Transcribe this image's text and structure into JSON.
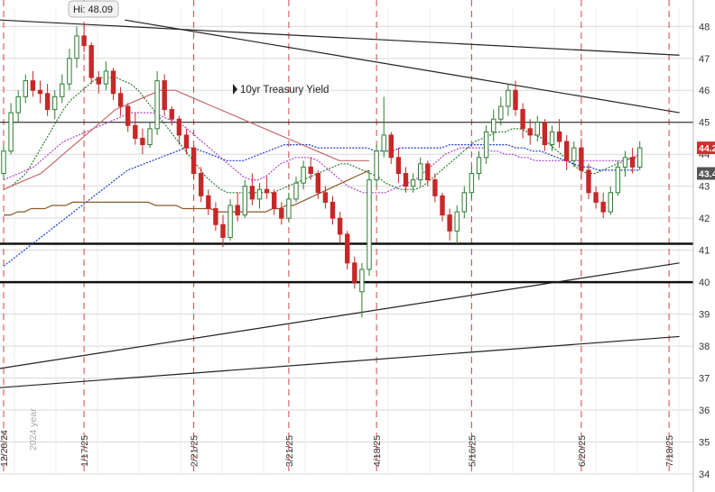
{
  "chart_data": {
    "type": "candlestick",
    "title": "10yr Treasury Yield",
    "high_label": "Hi: 48.09",
    "ylim": [
      34,
      48.6
    ],
    "y_ticks": [
      34,
      35,
      36,
      37,
      38,
      39,
      40,
      41,
      42,
      43,
      44,
      45,
      46,
      47,
      48
    ],
    "y_tick_labels": [
      "34",
      "35",
      "36",
      "37",
      "38",
      "39",
      "40",
      "41",
      "42",
      "43",
      "44",
      "45",
      "46",
      "47",
      "48"
    ],
    "date_labels": [
      "12/20/24",
      "1/17/25",
      "2/21/25",
      "3/21/25",
      "4/18/25",
      "5/16/25",
      "6/20/25",
      "7/18/25"
    ],
    "year_label": "2024 year",
    "price_tags": [
      {
        "text": "44.2",
        "value": 44.2,
        "color": "#d32f2f"
      },
      {
        "text": "43.4",
        "value": 43.4,
        "color": "#555555"
      }
    ],
    "horizontal_lines": [
      45.0,
      41.2,
      40.0
    ],
    "trendlines": [
      {
        "x0": 0,
        "y0": 48.2,
        "x1": 98,
        "y1": 47.1
      },
      {
        "x0": 18,
        "y0": 48.2,
        "x1": 98,
        "y1": 45.3
      },
      {
        "x0": 0,
        "y0": 37.3,
        "x1": 98,
        "y1": 40.6
      },
      {
        "x0": 0,
        "y0": 36.7,
        "x1": 98,
        "y1": 38.3
      }
    ],
    "date_index": [
      0,
      11,
      26,
      39,
      51,
      64,
      79,
      91
    ],
    "series": [
      {
        "name": "",
        "color": "#2e7d32",
        "style": "dashed",
        "values": [
          42.9,
          43.0,
          43.2,
          43.4,
          43.8,
          44.2,
          44.6,
          45.0,
          45.4,
          45.7,
          45.9,
          46.1,
          46.3,
          46.4,
          46.4,
          46.4,
          46.3,
          46.2,
          46.0,
          45.7,
          45.4,
          45.1,
          44.8,
          44.5,
          44.2,
          43.9,
          43.6,
          43.3,
          43.1,
          42.9,
          42.8,
          42.8,
          42.8,
          42.8,
          42.8,
          42.8,
          42.8,
          42.9,
          43.0,
          43.1,
          43.2,
          43.3,
          43.4,
          43.5,
          43.6,
          43.7,
          43.7,
          43.6,
          43.5,
          43.4,
          43.3,
          43.1,
          43.0,
          42.9,
          42.9,
          42.9,
          43.0,
          43.2,
          43.4,
          43.6,
          43.8,
          44.0,
          44.2,
          44.4,
          44.5,
          44.6,
          44.7,
          44.7,
          44.8,
          44.8,
          44.7,
          44.6,
          44.5,
          44.3,
          44.1,
          43.9,
          43.7,
          43.5,
          43.4,
          43.4,
          43.5,
          43.6,
          43.7,
          43.8,
          43.9,
          43.9
        ]
      },
      {
        "name": "",
        "color": "#b044c8",
        "style": "dashed",
        "values": [
          43.2,
          43.3,
          43.4,
          43.5,
          43.6,
          43.8,
          44.0,
          44.2,
          44.4,
          44.5,
          44.6,
          44.7,
          44.8,
          44.9,
          45.0,
          45.1,
          45.2,
          45.3,
          45.3,
          45.3,
          45.3,
          45.2,
          45.1,
          45.0,
          44.9,
          44.7,
          44.5,
          44.3,
          44.1,
          43.9,
          43.7,
          43.5,
          43.3,
          43.2,
          43.2,
          43.3,
          43.5,
          43.7,
          43.8,
          43.9,
          43.9,
          43.9,
          43.8,
          43.6,
          43.4,
          43.2,
          43.0,
          42.9,
          42.8,
          42.8,
          42.8,
          42.8,
          42.9,
          43.0,
          43.1,
          43.2,
          43.4,
          43.6,
          43.8,
          44.0,
          44.1,
          44.2,
          44.2,
          44.2,
          44.2,
          44.1,
          44.1,
          44.0,
          44.0,
          43.9,
          43.9,
          43.8,
          43.8,
          43.8,
          43.8,
          43.8,
          43.8,
          43.8,
          43.8,
          43.8,
          43.8,
          43.8,
          43.8,
          43.8,
          43.9,
          44.0
        ]
      },
      {
        "name": "",
        "color": "#1a3ccf",
        "style": "dashed",
        "values": [
          40.5,
          40.7,
          40.9,
          41.1,
          41.3,
          41.5,
          41.7,
          41.9,
          42.1,
          42.3,
          42.5,
          42.7,
          42.9,
          43.1,
          43.3,
          43.5,
          43.6,
          43.7,
          43.8,
          43.9,
          44.0,
          44.1,
          44.2,
          44.2,
          44.1,
          44.0,
          43.9,
          43.8,
          43.8,
          43.8,
          43.9,
          44.0,
          44.1,
          44.2,
          44.3,
          44.3,
          44.3,
          44.3,
          44.2,
          44.2,
          44.2,
          44.2,
          44.2,
          44.2,
          44.2,
          44.1,
          44.1,
          44.1,
          44.2,
          44.2,
          44.2,
          44.2,
          44.2,
          44.2,
          44.3,
          44.3,
          44.3,
          44.3,
          44.3,
          44.3,
          44.3,
          44.3,
          44.2,
          44.2,
          44.1,
          44.1,
          44.0,
          43.9,
          43.8,
          43.7,
          43.6,
          43.6,
          43.5,
          43.5,
          43.5,
          43.5,
          43.5,
          43.5
        ]
      },
      {
        "name": "",
        "color": "#8b5a2b",
        "style": "solid",
        "values": [
          42.1,
          42.1,
          42.2,
          42.2,
          42.3,
          42.3,
          42.3,
          42.4,
          42.4,
          42.4,
          42.5,
          42.5,
          42.5,
          42.5,
          42.5,
          42.5,
          42.5,
          42.5,
          42.5,
          42.5,
          42.5,
          42.5,
          42.4,
          42.4,
          42.4,
          42.4,
          42.3,
          42.3,
          42.3,
          42.3,
          42.3,
          42.2,
          42.2,
          42.2,
          42.2,
          42.2,
          42.2,
          42.2,
          42.2,
          42.3,
          42.3,
          42.4,
          42.4,
          42.5,
          42.6,
          42.7,
          42.8,
          42.9,
          43.0,
          43.1,
          43.2,
          43.3,
          43.4,
          43.5
        ]
      },
      {
        "name": "",
        "color": "#c46a6a",
        "style": "solid",
        "values": [
          42.9,
          43.0,
          43.1,
          43.2,
          43.3,
          43.4,
          43.6,
          43.8,
          44.0,
          44.2,
          44.4,
          44.6,
          44.8,
          45.0,
          45.2,
          45.4,
          45.5,
          45.6,
          45.7,
          45.8,
          45.9,
          46.0,
          46.0,
          46.0,
          45.9,
          45.8,
          45.7,
          45.6,
          45.5,
          45.4,
          45.3,
          45.2,
          45.1,
          45.0,
          44.9,
          44.8,
          44.7,
          44.6,
          44.5,
          44.4,
          44.3,
          44.2,
          44.1,
          44.0,
          43.9,
          43.8,
          43.8,
          43.8,
          43.8,
          43.8
        ]
      }
    ],
    "candles": [
      {
        "o": 43.4,
        "h": 44.3,
        "l": 43.2,
        "c": 44.1
      },
      {
        "o": 44.1,
        "h": 45.6,
        "l": 44.0,
        "c": 45.3
      },
      {
        "o": 45.3,
        "h": 46.0,
        "l": 45.0,
        "c": 45.8
      },
      {
        "o": 45.8,
        "h": 46.5,
        "l": 45.6,
        "c": 46.3
      },
      {
        "o": 46.3,
        "h": 46.6,
        "l": 45.8,
        "c": 46.0
      },
      {
        "o": 46.0,
        "h": 46.3,
        "l": 45.6,
        "c": 45.9
      },
      {
        "o": 45.9,
        "h": 46.2,
        "l": 45.2,
        "c": 45.4
      },
      {
        "o": 45.4,
        "h": 46.0,
        "l": 45.1,
        "c": 45.8
      },
      {
        "o": 45.8,
        "h": 46.5,
        "l": 45.6,
        "c": 46.2
      },
      {
        "o": 46.2,
        "h": 47.3,
        "l": 46.0,
        "c": 47.0
      },
      {
        "o": 47.0,
        "h": 48.0,
        "l": 46.7,
        "c": 47.7
      },
      {
        "o": 47.7,
        "h": 48.09,
        "l": 47.2,
        "c": 47.4
      },
      {
        "o": 47.4,
        "h": 47.5,
        "l": 46.2,
        "c": 46.4
      },
      {
        "o": 46.4,
        "h": 46.6,
        "l": 45.9,
        "c": 46.2
      },
      {
        "o": 46.2,
        "h": 46.9,
        "l": 46.0,
        "c": 46.6
      },
      {
        "o": 46.6,
        "h": 46.7,
        "l": 45.7,
        "c": 45.9
      },
      {
        "o": 45.9,
        "h": 46.1,
        "l": 45.2,
        "c": 45.5
      },
      {
        "o": 45.5,
        "h": 45.6,
        "l": 44.7,
        "c": 44.9
      },
      {
        "o": 44.9,
        "h": 45.3,
        "l": 44.3,
        "c": 44.5
      },
      {
        "o": 44.5,
        "h": 44.8,
        "l": 44.0,
        "c": 44.3
      },
      {
        "o": 44.3,
        "h": 45.0,
        "l": 44.2,
        "c": 44.8
      },
      {
        "o": 44.8,
        "h": 46.6,
        "l": 44.6,
        "c": 46.3
      },
      {
        "o": 46.3,
        "h": 46.5,
        "l": 45.2,
        "c": 45.4
      },
      {
        "o": 45.4,
        "h": 45.5,
        "l": 44.9,
        "c": 45.1
      },
      {
        "o": 45.1,
        "h": 45.2,
        "l": 44.3,
        "c": 44.6
      },
      {
        "o": 44.6,
        "h": 44.8,
        "l": 44.0,
        "c": 44.2
      },
      {
        "o": 44.2,
        "h": 44.3,
        "l": 43.2,
        "c": 43.4
      },
      {
        "o": 43.4,
        "h": 43.6,
        "l": 42.5,
        "c": 42.7
      },
      {
        "o": 42.7,
        "h": 42.9,
        "l": 42.1,
        "c": 42.3
      },
      {
        "o": 42.3,
        "h": 42.5,
        "l": 41.6,
        "c": 41.8
      },
      {
        "o": 41.8,
        "h": 42.1,
        "l": 41.1,
        "c": 41.4
      },
      {
        "o": 41.4,
        "h": 42.6,
        "l": 41.3,
        "c": 42.4
      },
      {
        "o": 42.4,
        "h": 42.8,
        "l": 41.9,
        "c": 42.1
      },
      {
        "o": 42.1,
        "h": 43.2,
        "l": 42.0,
        "c": 43.0
      },
      {
        "o": 43.0,
        "h": 43.4,
        "l": 42.4,
        "c": 42.6
      },
      {
        "o": 42.6,
        "h": 43.1,
        "l": 42.3,
        "c": 42.9
      },
      {
        "o": 42.9,
        "h": 43.3,
        "l": 42.6,
        "c": 42.8
      },
      {
        "o": 42.8,
        "h": 42.9,
        "l": 42.1,
        "c": 42.3
      },
      {
        "o": 42.3,
        "h": 42.5,
        "l": 41.8,
        "c": 42.0
      },
      {
        "o": 42.0,
        "h": 42.8,
        "l": 41.9,
        "c": 42.6
      },
      {
        "o": 42.6,
        "h": 43.3,
        "l": 42.5,
        "c": 43.1
      },
      {
        "o": 43.1,
        "h": 43.8,
        "l": 42.9,
        "c": 43.6
      },
      {
        "o": 43.6,
        "h": 43.9,
        "l": 43.2,
        "c": 43.4
      },
      {
        "o": 43.4,
        "h": 43.5,
        "l": 42.6,
        "c": 42.8
      },
      {
        "o": 42.8,
        "h": 43.0,
        "l": 42.3,
        "c": 42.5
      },
      {
        "o": 42.5,
        "h": 42.7,
        "l": 41.8,
        "c": 42.0
      },
      {
        "o": 42.0,
        "h": 42.2,
        "l": 41.2,
        "c": 41.5
      },
      {
        "o": 41.5,
        "h": 41.6,
        "l": 40.4,
        "c": 40.6
      },
      {
        "o": 40.6,
        "h": 40.8,
        "l": 39.8,
        "c": 40.0
      },
      {
        "o": 39.7,
        "h": 40.6,
        "l": 38.9,
        "c": 40.4
      },
      {
        "o": 40.4,
        "h": 43.5,
        "l": 40.2,
        "c": 43.2
      },
      {
        "o": 43.2,
        "h": 44.3,
        "l": 43.0,
        "c": 44.1
      },
      {
        "o": 44.1,
        "h": 45.8,
        "l": 43.9,
        "c": 44.6
      },
      {
        "o": 44.6,
        "h": 44.7,
        "l": 43.7,
        "c": 43.9
      },
      {
        "o": 43.9,
        "h": 44.2,
        "l": 43.1,
        "c": 43.4
      },
      {
        "o": 43.4,
        "h": 43.6,
        "l": 42.8,
        "c": 43.0
      },
      {
        "o": 43.0,
        "h": 43.4,
        "l": 42.8,
        "c": 43.2
      },
      {
        "o": 43.2,
        "h": 43.9,
        "l": 43.0,
        "c": 43.7
      },
      {
        "o": 43.7,
        "h": 43.8,
        "l": 43.0,
        "c": 43.2
      },
      {
        "o": 43.2,
        "h": 43.4,
        "l": 42.5,
        "c": 42.7
      },
      {
        "o": 42.7,
        "h": 42.8,
        "l": 41.9,
        "c": 42.1
      },
      {
        "o": 42.1,
        "h": 42.3,
        "l": 41.3,
        "c": 41.6
      },
      {
        "o": 41.6,
        "h": 42.4,
        "l": 41.2,
        "c": 42.2
      },
      {
        "o": 42.2,
        "h": 43.0,
        "l": 42.0,
        "c": 42.8
      },
      {
        "o": 42.8,
        "h": 43.6,
        "l": 42.6,
        "c": 43.4
      },
      {
        "o": 43.4,
        "h": 44.1,
        "l": 43.2,
        "c": 43.9
      },
      {
        "o": 43.9,
        "h": 44.9,
        "l": 43.7,
        "c": 44.7
      },
      {
        "o": 44.7,
        "h": 45.4,
        "l": 44.4,
        "c": 45.1
      },
      {
        "o": 45.1,
        "h": 45.8,
        "l": 44.9,
        "c": 45.5
      },
      {
        "o": 45.5,
        "h": 46.2,
        "l": 45.2,
        "c": 46.0
      },
      {
        "o": 46.0,
        "h": 46.3,
        "l": 45.2,
        "c": 45.4
      },
      {
        "o": 45.4,
        "h": 45.6,
        "l": 44.5,
        "c": 44.8
      },
      {
        "o": 44.8,
        "h": 45.1,
        "l": 44.3,
        "c": 44.6
      },
      {
        "o": 44.6,
        "h": 45.2,
        "l": 44.4,
        "c": 45.0
      },
      {
        "o": 45.0,
        "h": 45.1,
        "l": 44.1,
        "c": 44.3
      },
      {
        "o": 44.3,
        "h": 44.9,
        "l": 44.1,
        "c": 44.7
      },
      {
        "o": 44.7,
        "h": 45.1,
        "l": 44.2,
        "c": 44.4
      },
      {
        "o": 44.4,
        "h": 44.6,
        "l": 43.5,
        "c": 43.8
      },
      {
        "o": 43.8,
        "h": 44.4,
        "l": 43.6,
        "c": 44.2
      },
      {
        "o": 44.2,
        "h": 44.5,
        "l": 43.2,
        "c": 43.5
      },
      {
        "o": 43.5,
        "h": 43.7,
        "l": 42.6,
        "c": 42.8
      },
      {
        "o": 42.8,
        "h": 43.0,
        "l": 42.3,
        "c": 42.5
      },
      {
        "o": 42.5,
        "h": 42.8,
        "l": 42.0,
        "c": 42.2
      },
      {
        "o": 42.2,
        "h": 43.0,
        "l": 42.1,
        "c": 42.8
      },
      {
        "o": 42.8,
        "h": 43.8,
        "l": 42.7,
        "c": 43.6
      },
      {
        "o": 43.6,
        "h": 44.1,
        "l": 43.3,
        "c": 43.9
      },
      {
        "o": 43.9,
        "h": 44.2,
        "l": 43.4,
        "c": 43.6
      },
      {
        "o": 43.6,
        "h": 44.4,
        "l": 43.5,
        "c": 44.2
      }
    ],
    "colors": {
      "up": "#2e7d32",
      "down": "#c62828",
      "grid": "#d9d9d9",
      "vline": "#c62828"
    }
  }
}
